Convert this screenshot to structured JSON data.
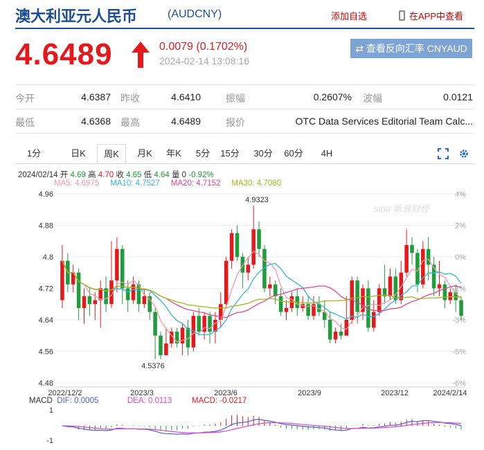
{
  "header": {
    "title": "澳大利亚元人民币",
    "symbol": "(AUDCNY)",
    "add_fav": "添加自选",
    "open_app": "在APP中查看",
    "price": "4.6489",
    "change": "0.0079 (0.1702%)",
    "timestamp": "2024-02-14 13:08:16",
    "reverse_btn": "⇄ 查看反向汇率 CNYAUD"
  },
  "stats": {
    "open_label": "今开",
    "open": "4.6387",
    "prev_label": "昨收",
    "prev": "4.6410",
    "amp_label": "振幅",
    "amp": "0.2607%",
    "wave_label": "波幅",
    "wave": "0.0121",
    "low_label": "最低",
    "low": "4.6368",
    "high_label": "最高",
    "high": "4.6489",
    "quote_label": "报价",
    "quote": "OTC Data Services Editorial Team Calc..."
  },
  "tabs": [
    "1分",
    "日K",
    "周K",
    "月K",
    "年K",
    "5分",
    "15分",
    "30分",
    "60分",
    "4H"
  ],
  "active_tab": "周K",
  "info": {
    "date": "2024/02/14",
    "open_l": "开",
    "open": "4.69",
    "high_l": "高",
    "high": "4.70",
    "close_l": "收",
    "close": "4.65",
    "low_l": "低",
    "low": "4.64",
    "vol_l": "量",
    "vol": "0",
    "pct": "-0.92%"
  },
  "ma": {
    "ma5": "MA5: 4.6975",
    "ma10": "MA10: 4.7527",
    "ma20": "MA20: 4.7152",
    "ma30": "MA30: 4.7080"
  },
  "macd": {
    "label": "MACD",
    "dif": "DIF: 0.0005",
    "dea": "DEA: 0.0113",
    "macd": "MACD: -0.0217"
  },
  "colors": {
    "up": "#e5191c",
    "down": "#1f9c3b",
    "ma5": "#f39aa8",
    "ma10": "#35b6d8",
    "ma20": "#e0488a",
    "ma30": "#a3b91b",
    "dif": "#4b61d1",
    "dea": "#dd44cc",
    "brand": "#1c4e94"
  },
  "watermark": "sina 新浪财经",
  "chart_data": {
    "type": "candlestick",
    "period": "weekly",
    "ylim": [
      4.48,
      4.96
    ],
    "y_ticks": [
      "4.96",
      "4.88",
      "4.8",
      "4.72",
      "4.64",
      "4.56",
      "4.48"
    ],
    "pct_ticks": [
      "4%",
      "2%",
      "0%",
      "-1%",
      "-3%",
      "-5%",
      "-6%"
    ],
    "x_ticks": [
      "2022/12/2",
      "2023/3",
      "2023/6",
      "2023/9",
      "2023/12",
      "2024/2/14"
    ],
    "annotations": [
      {
        "label": "4.9323",
        "value": 4.9323
      },
      {
        "label": "4.5376",
        "value": 4.5376
      }
    ],
    "candles": [
      [
        4.69,
        4.79,
        4.67,
        4.83
      ],
      [
        4.79,
        4.73,
        4.71,
        4.81
      ],
      [
        4.73,
        4.76,
        4.71,
        4.78
      ],
      [
        4.76,
        4.67,
        4.64,
        4.77
      ],
      [
        4.67,
        4.7,
        4.63,
        4.72
      ],
      [
        4.7,
        4.68,
        4.65,
        4.72
      ],
      [
        4.68,
        4.69,
        4.64,
        4.71
      ],
      [
        4.69,
        4.72,
        4.62,
        4.74
      ],
      [
        4.72,
        4.68,
        4.66,
        4.75
      ],
      [
        4.68,
        4.74,
        4.67,
        4.84
      ],
      [
        4.74,
        4.82,
        4.71,
        4.85
      ],
      [
        4.82,
        4.72,
        4.68,
        4.83
      ],
      [
        4.72,
        4.69,
        4.66,
        4.74
      ],
      [
        4.69,
        4.73,
        4.68,
        4.75
      ],
      [
        4.73,
        4.68,
        4.66,
        4.74
      ],
      [
        4.68,
        4.7,
        4.67,
        4.72
      ],
      [
        4.7,
        4.66,
        4.64,
        4.71
      ],
      [
        4.66,
        4.6,
        4.54,
        4.67
      ],
      [
        4.6,
        4.55,
        4.54,
        4.61
      ],
      [
        4.55,
        4.58,
        4.55,
        4.62
      ],
      [
        4.58,
        4.61,
        4.57,
        4.62
      ],
      [
        4.61,
        4.58,
        4.57,
        4.62
      ],
      [
        4.58,
        4.62,
        4.55,
        4.63
      ],
      [
        4.62,
        4.57,
        4.55,
        4.64
      ],
      [
        4.57,
        4.65,
        4.56,
        4.66
      ],
      [
        4.65,
        4.61,
        4.6,
        4.67
      ],
      [
        4.61,
        4.65,
        4.59,
        4.66
      ],
      [
        4.65,
        4.61,
        4.58,
        4.66
      ],
      [
        4.61,
        4.64,
        4.58,
        4.66
      ],
      [
        4.64,
        4.68,
        4.62,
        4.71
      ],
      [
        4.68,
        4.79,
        4.67,
        4.8
      ],
      [
        4.79,
        4.86,
        4.77,
        4.87
      ],
      [
        4.86,
        4.8,
        4.79,
        4.88
      ],
      [
        4.8,
        4.76,
        4.72,
        4.81
      ],
      [
        4.76,
        4.78,
        4.74,
        4.8
      ],
      [
        4.78,
        4.87,
        4.77,
        4.93
      ],
      [
        4.87,
        4.82,
        4.8,
        4.89
      ],
      [
        4.82,
        4.72,
        4.71,
        4.83
      ],
      [
        4.72,
        4.73,
        4.7,
        4.75
      ],
      [
        4.73,
        4.7,
        4.68,
        4.74
      ],
      [
        4.7,
        4.66,
        4.65,
        4.72
      ],
      [
        4.66,
        4.67,
        4.64,
        4.69
      ],
      [
        4.67,
        4.7,
        4.66,
        4.71
      ],
      [
        4.7,
        4.67,
        4.65,
        4.72
      ],
      [
        4.67,
        4.68,
        4.66,
        4.7
      ],
      [
        4.68,
        4.65,
        4.64,
        4.7
      ],
      [
        4.65,
        4.68,
        4.64,
        4.7
      ],
      [
        4.68,
        4.66,
        4.65,
        4.7
      ],
      [
        4.66,
        4.64,
        4.62,
        4.69
      ],
      [
        4.64,
        4.59,
        4.58,
        4.66
      ],
      [
        4.59,
        4.61,
        4.58,
        4.62
      ],
      [
        4.61,
        4.6,
        4.59,
        4.63
      ],
      [
        4.6,
        4.64,
        4.6,
        4.7
      ],
      [
        4.64,
        4.74,
        4.63,
        4.75
      ],
      [
        4.74,
        4.66,
        4.63,
        4.75
      ],
      [
        4.66,
        4.72,
        4.64,
        4.73
      ],
      [
        4.72,
        4.62,
        4.61,
        4.74
      ],
      [
        4.62,
        4.66,
        4.61,
        4.69
      ],
      [
        4.66,
        4.72,
        4.65,
        4.73
      ],
      [
        4.72,
        4.7,
        4.68,
        4.78
      ],
      [
        4.7,
        4.75,
        4.69,
        4.77
      ],
      [
        4.75,
        4.69,
        4.68,
        4.77
      ],
      [
        4.69,
        4.76,
        4.68,
        4.79
      ],
      [
        4.76,
        4.83,
        4.75,
        4.87
      ],
      [
        4.83,
        4.81,
        4.78,
        4.85
      ],
      [
        4.81,
        4.73,
        4.71,
        4.82
      ],
      [
        4.73,
        4.82,
        4.72,
        4.84
      ],
      [
        4.82,
        4.78,
        4.74,
        4.85
      ],
      [
        4.78,
        4.72,
        4.7,
        4.8
      ],
      [
        4.72,
        4.73,
        4.7,
        4.79
      ],
      [
        4.73,
        4.69,
        4.67,
        4.74
      ],
      [
        4.69,
        4.71,
        4.68,
        4.72
      ],
      [
        4.71,
        4.69,
        4.66,
        4.73
      ],
      [
        4.69,
        4.65,
        4.64,
        4.7
      ]
    ]
  }
}
